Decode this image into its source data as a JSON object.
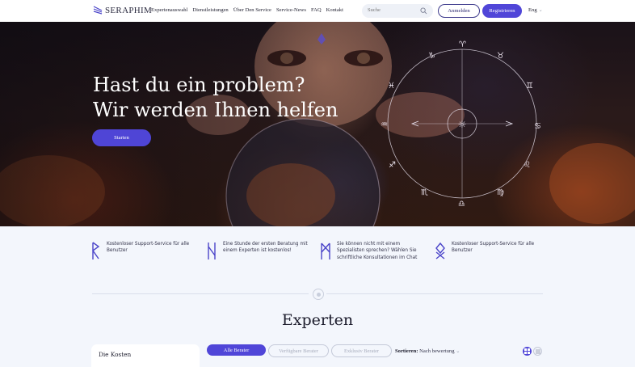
{
  "header": {
    "logo_text": "SERAPHIM",
    "nav": [
      "Expertenauswahl",
      "Dienstleistungen",
      "Über Den Service",
      "Service-News",
      "FAQ",
      "Kontakt"
    ],
    "search_placeholder": "Suche",
    "login_label": "Anmelden",
    "register_label": "Registrieren",
    "language": "Eng"
  },
  "hero": {
    "title_line1": "Hast du ein problem?",
    "title_line2": "Wir werden Ihnen helfen",
    "start_label": "Starten"
  },
  "features": [
    {
      "icon": "rune-r-icon",
      "text_lines": [
        "Kostenloser Support-Service für alle",
        "Benutzer"
      ]
    },
    {
      "icon": "rune-n-icon",
      "text_lines": [
        "Eine Stunde der ersten Beratung mit",
        "einem Experten ist kostenlos!"
      ]
    },
    {
      "icon": "rune-m-icon",
      "text_lines": [
        "Sie können nicht mit einem",
        "Spezialisten sprechen? Wählen Sie",
        "schriftliche Konsultationen im Chat"
      ]
    },
    {
      "icon": "rune-diamond-icon",
      "text_lines": [
        "Kostenloser Support-Service für alle",
        "Benutzer"
      ]
    }
  ],
  "experts": {
    "title": "Experten",
    "cost_title": "Die Kosten",
    "filters": [
      "Alle Berater",
      "Verfügbare Berater",
      "Exklusiv Berater"
    ],
    "sort_label": "Sortieren:",
    "sort_value": "Nach bewertung"
  },
  "colors": {
    "accent": "#5046d8",
    "page_bg": "#f3f6fc",
    "text_dark": "#1c1c2c"
  }
}
